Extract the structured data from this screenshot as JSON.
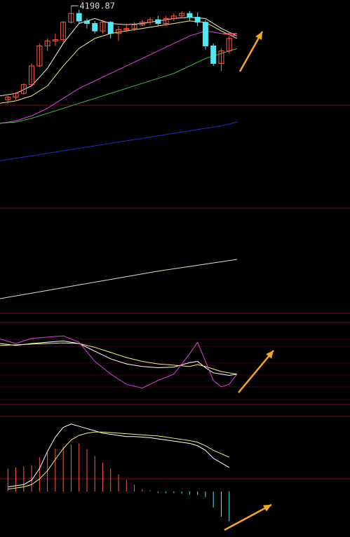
{
  "title": "",
  "colors": {
    "background": "#000000",
    "separator": "#7a0c1a",
    "up": "#ff5a4a",
    "down": "#55e7f2",
    "ma_white": "#f0f0e0",
    "ma_yellow": "#f5f07a",
    "ma_magenta": "#e040e0",
    "ma_green": "#40c040",
    "ma_blue": "#2030c0",
    "volume_line": "#e0e0c0",
    "kdj_k": "#ffffff",
    "kdj_d": "#f5f07a",
    "kdj_j": "#e040e0",
    "macd_dif": "#ffffff",
    "macd_dea": "#f5f07a",
    "macd_pos": "#ff5a4a",
    "macd_neg": "#55e7f2",
    "arrow": "#f5a623"
  },
  "price_panel": {
    "high_label": "4190.87",
    "high_value": 4190.87
  },
  "chart_data": [
    {
      "type": "candlestick",
      "name": "price",
      "x": [
        1,
        2,
        3,
        4,
        5,
        6,
        7,
        8,
        9,
        10,
        11,
        12,
        13,
        14,
        15,
        16,
        17,
        18,
        19,
        20,
        21,
        22,
        23,
        24,
        25,
        26,
        27,
        28,
        29
      ],
      "ohlc": [
        [
          3815,
          3830,
          3800,
          3825
        ],
        [
          3825,
          3845,
          3815,
          3840
        ],
        [
          3840,
          3880,
          3835,
          3875
        ],
        [
          3875,
          3960,
          3870,
          3950
        ],
        [
          3950,
          4040,
          3945,
          4030
        ],
        [
          4030,
          4060,
          4010,
          4050
        ],
        [
          4050,
          4080,
          4030,
          4055
        ],
        [
          4055,
          4130,
          4045,
          4125
        ],
        [
          4125,
          4190.87,
          4120,
          4160
        ],
        [
          4160,
          4175,
          4120,
          4130
        ],
        [
          4130,
          4140,
          4100,
          4120
        ],
        [
          4120,
          4130,
          4080,
          4090
        ],
        [
          4090,
          4135,
          4080,
          4125
        ],
        [
          4125,
          4130,
          4060,
          4080
        ],
        [
          4080,
          4110,
          4050,
          4095
        ],
        [
          4095,
          4120,
          4085,
          4100
        ],
        [
          4100,
          4125,
          4090,
          4115
        ],
        [
          4115,
          4135,
          4110,
          4125
        ],
        [
          4125,
          4145,
          4115,
          4135
        ],
        [
          4135,
          4150,
          4110,
          4120
        ],
        [
          4120,
          4150,
          4110,
          4140
        ],
        [
          4140,
          4160,
          4130,
          4150
        ],
        [
          4150,
          4170,
          4140,
          4160
        ],
        [
          4160,
          4170,
          4130,
          4145
        ],
        [
          4145,
          4165,
          4110,
          4125
        ],
        [
          4125,
          4135,
          4015,
          4030
        ],
        [
          4030,
          4040,
          3950,
          3960
        ],
        [
          3960,
          4020,
          3930,
          4010
        ],
        [
          4010,
          4070,
          4000,
          4060
        ]
      ]
    },
    {
      "type": "line",
      "name": "moving_averages",
      "x": [
        0,
        2,
        4,
        6,
        8,
        10,
        12,
        14,
        16,
        18,
        20,
        22,
        24,
        26,
        28,
        30
      ],
      "series": [
        {
          "color_key": "ma_white",
          "values": [
            3830,
            3840,
            3870,
            3940,
            4040,
            4120,
            4140,
            4120,
            4115,
            4120,
            4130,
            4140,
            4145,
            4140,
            4100,
            4070
          ]
        },
        {
          "color_key": "ma_yellow",
          "values": [
            3800,
            3810,
            3830,
            3870,
            3950,
            4020,
            4060,
            4080,
            4090,
            4100,
            4110,
            4120,
            4130,
            4125,
            4090,
            4060
          ]
        },
        {
          "color_key": "ma_magenta",
          "values": [
            3720,
            3730,
            3750,
            3780,
            3820,
            3860,
            3890,
            3920,
            3950,
            3980,
            4010,
            4040,
            4070,
            4090,
            4080,
            4070
          ]
        },
        {
          "color_key": "ma_green",
          "values": [
            3720,
            3725,
            3740,
            3760,
            3780,
            3800,
            3820,
            3840,
            3860,
            3880,
            3900,
            3920,
            3950,
            3980,
            4000,
            4020
          ]
        },
        {
          "color_key": "ma_blue",
          "values": [
            3570,
            3580,
            3590,
            3600,
            3610,
            3620,
            3630,
            3640,
            3650,
            3660,
            3670,
            3680,
            3690,
            3700,
            3710,
            3725
          ]
        }
      ]
    },
    {
      "type": "line",
      "name": "volume_trend",
      "x": [
        0,
        5,
        10,
        15,
        20,
        25,
        30
      ],
      "values": [
        10,
        17,
        24,
        31,
        38,
        44,
        50
      ],
      "ylim": [
        0,
        100
      ]
    },
    {
      "type": "line",
      "name": "kdj",
      "x": [
        0,
        2,
        4,
        6,
        8,
        10,
        12,
        14,
        16,
        18,
        20,
        22,
        24,
        25,
        26,
        27,
        28,
        29,
        30
      ],
      "series": [
        {
          "color_key": "kdj_k",
          "values": [
            88,
            85,
            88,
            90,
            92,
            88,
            76,
            64,
            56,
            52,
            50,
            51,
            58,
            60,
            50,
            42,
            40,
            38,
            40
          ]
        },
        {
          "color_key": "kdj_d",
          "values": [
            85,
            86,
            87,
            88,
            89,
            88,
            82,
            74,
            66,
            60,
            56,
            54,
            52,
            55,
            52,
            48,
            44,
            42,
            40
          ]
        },
        {
          "color_key": "kdj_j",
          "values": [
            95,
            88,
            96,
            98,
            100,
            90,
            60,
            40,
            24,
            18,
            30,
            40,
            72,
            90,
            60,
            30,
            20,
            24,
            40
          ]
        }
      ],
      "ylim": [
        0,
        110
      ]
    },
    {
      "type": "bar",
      "name": "macd",
      "x": [
        1,
        2,
        3,
        4,
        5,
        6,
        7,
        8,
        9,
        10,
        11,
        12,
        13,
        14,
        15,
        16,
        17,
        18,
        19,
        20,
        21,
        22,
        23,
        24,
        25,
        26,
        27,
        28,
        29
      ],
      "values": [
        40,
        42,
        44,
        46,
        60,
        68,
        75,
        78,
        82,
        84,
        74,
        62,
        50,
        40,
        30,
        20,
        12,
        4,
        2,
        -2,
        -3,
        -3,
        -4,
        -5,
        -6,
        -10,
        -28,
        -44,
        -52
      ],
      "dif": [
        8,
        10,
        12,
        20,
        40,
        70,
        95,
        112,
        118,
        114,
        110,
        106,
        102,
        100,
        98,
        96,
        96,
        95,
        94,
        92,
        90,
        88,
        86,
        84,
        80,
        72,
        58,
        50,
        42
      ],
      "dea": [
        4,
        6,
        8,
        12,
        22,
        36,
        56,
        75,
        90,
        98,
        102,
        104,
        104,
        103,
        102,
        101,
        100,
        99,
        98,
        97,
        95,
        93,
        91,
        89,
        86,
        80,
        72,
        66,
        60
      ],
      "ylim": [
        -60,
        130
      ]
    }
  ]
}
